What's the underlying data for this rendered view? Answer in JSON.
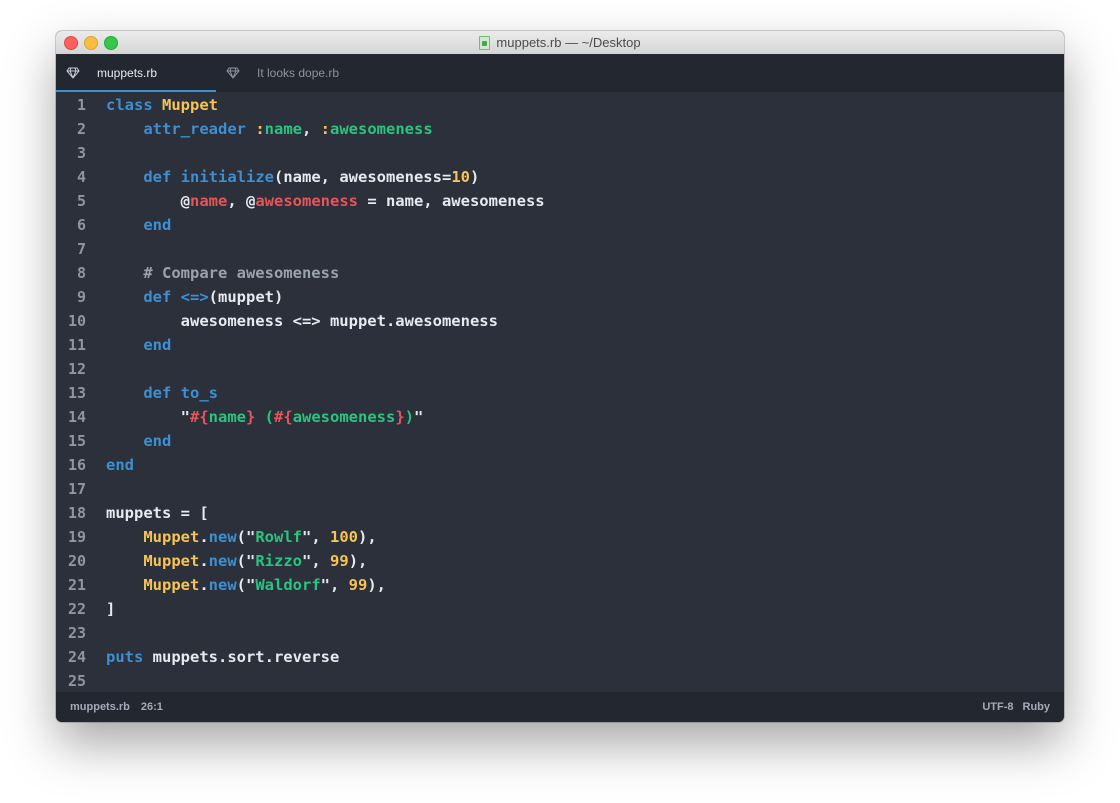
{
  "window": {
    "title": "muppets.rb — ~/Desktop"
  },
  "tabs": [
    {
      "label": "muppets.rb",
      "active": true
    },
    {
      "label": "It looks dope.rb",
      "active": false
    }
  ],
  "colors": {
    "background": "#2b303b",
    "keyword": "#3d8fd1",
    "constant": "#f7c453",
    "symbol": "#29c47f",
    "ivar": "#e8545a",
    "number": "#f7c453",
    "comment": "#9aa2ae",
    "text": "#e6e9ee",
    "accent": "#3d8fd1"
  },
  "editor": {
    "lines": [
      [
        [
          "k",
          "class"
        ],
        [
          "t",
          " "
        ],
        [
          "c",
          "Muppet"
        ]
      ],
      [
        [
          "t",
          "    "
        ],
        [
          "k",
          "attr_reader"
        ],
        [
          "t",
          " "
        ],
        [
          "c",
          ":"
        ],
        [
          "s",
          "name"
        ],
        [
          "t",
          ", "
        ],
        [
          "c",
          ":"
        ],
        [
          "s",
          "awesomeness"
        ]
      ],
      [],
      [
        [
          "t",
          "    "
        ],
        [
          "k",
          "def"
        ],
        [
          "t",
          " "
        ],
        [
          "k",
          "initialize"
        ],
        [
          "t",
          "(name, awesomeness="
        ],
        [
          "n",
          "10"
        ],
        [
          "t",
          ")"
        ]
      ],
      [
        [
          "t",
          "        @"
        ],
        [
          "i",
          "name"
        ],
        [
          "t",
          ", @"
        ],
        [
          "i",
          "awesomeness"
        ],
        [
          "t",
          " = name, awesomeness"
        ]
      ],
      [
        [
          "t",
          "    "
        ],
        [
          "k",
          "end"
        ]
      ],
      [],
      [
        [
          "t",
          "    "
        ],
        [
          "m",
          "# Compare awesomeness"
        ]
      ],
      [
        [
          "t",
          "    "
        ],
        [
          "k",
          "def"
        ],
        [
          "t",
          " "
        ],
        [
          "k",
          "<=>"
        ],
        [
          "t",
          "(muppet)"
        ]
      ],
      [
        [
          "t",
          "        awesomeness <=> muppet.awesomeness"
        ]
      ],
      [
        [
          "t",
          "    "
        ],
        [
          "k",
          "end"
        ]
      ],
      [],
      [
        [
          "t",
          "    "
        ],
        [
          "k",
          "def"
        ],
        [
          "t",
          " "
        ],
        [
          "k",
          "to_s"
        ]
      ],
      [
        [
          "t",
          "        \""
        ],
        [
          "i",
          "#{"
        ],
        [
          "s",
          "name"
        ],
        [
          "i",
          "}"
        ],
        [
          "s",
          " ("
        ],
        [
          "i",
          "#{"
        ],
        [
          "s",
          "awesomeness"
        ],
        [
          "i",
          "}"
        ],
        [
          "s",
          ")"
        ],
        [
          "t",
          "\""
        ]
      ],
      [
        [
          "t",
          "    "
        ],
        [
          "k",
          "end"
        ]
      ],
      [
        [
          "k",
          "end"
        ]
      ],
      [],
      [
        [
          "t",
          "muppets = ["
        ]
      ],
      [
        [
          "t",
          "    "
        ],
        [
          "c",
          "Muppet"
        ],
        [
          "t",
          "."
        ],
        [
          "k",
          "new"
        ],
        [
          "t",
          "(\""
        ],
        [
          "s",
          "Rowlf"
        ],
        [
          "t",
          "\", "
        ],
        [
          "n",
          "100"
        ],
        [
          "t",
          "),"
        ]
      ],
      [
        [
          "t",
          "    "
        ],
        [
          "c",
          "Muppet"
        ],
        [
          "t",
          "."
        ],
        [
          "k",
          "new"
        ],
        [
          "t",
          "(\""
        ],
        [
          "s",
          "Rizzo"
        ],
        [
          "t",
          "\", "
        ],
        [
          "n",
          "99"
        ],
        [
          "t",
          "),"
        ]
      ],
      [
        [
          "t",
          "    "
        ],
        [
          "c",
          "Muppet"
        ],
        [
          "t",
          "."
        ],
        [
          "k",
          "new"
        ],
        [
          "t",
          "(\""
        ],
        [
          "s",
          "Waldorf"
        ],
        [
          "t",
          "\", "
        ],
        [
          "n",
          "99"
        ],
        [
          "t",
          "),"
        ]
      ],
      [
        [
          "t",
          "]"
        ]
      ],
      [],
      [
        [
          "k",
          "puts"
        ],
        [
          "t",
          " muppets.sort.reverse"
        ]
      ],
      []
    ]
  },
  "status": {
    "file": "muppets.rb",
    "cursor": "26:1",
    "encoding": "UTF-8",
    "grammar": "Ruby"
  }
}
